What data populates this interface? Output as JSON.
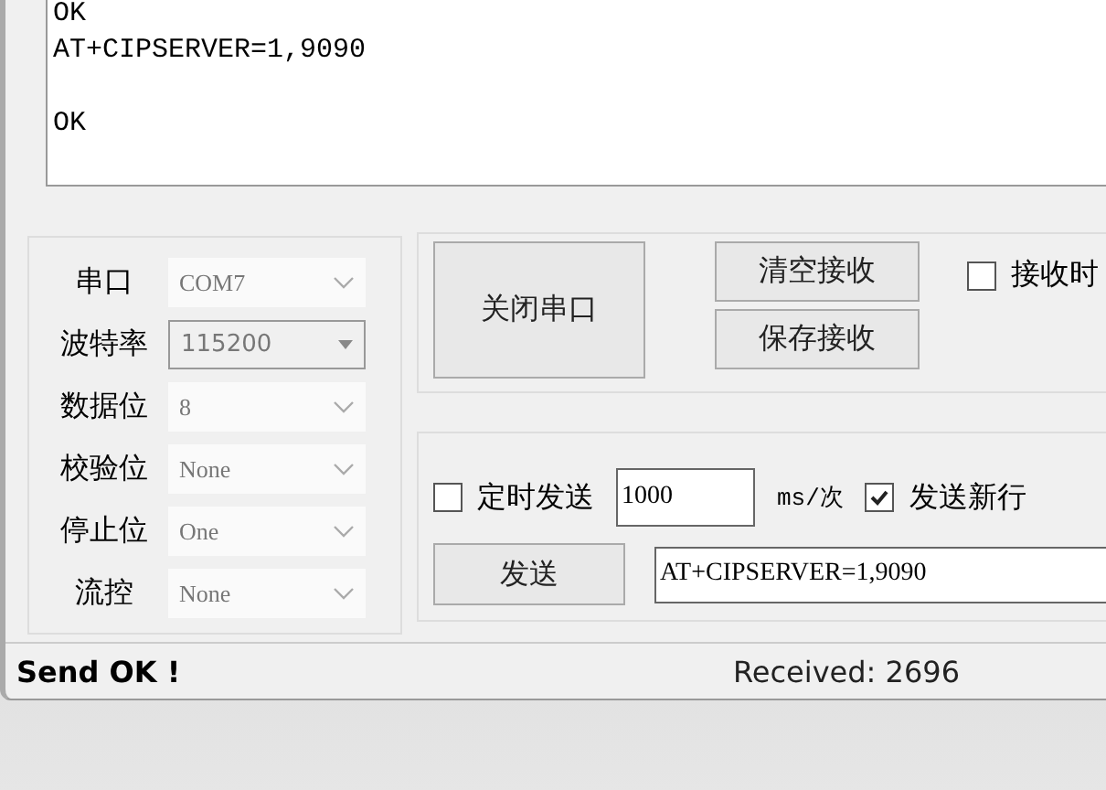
{
  "receive_area": {
    "lines": [
      {
        "text": "OK",
        "gap_before": false
      },
      {
        "text": "AT+CIPSERVER=1,9090",
        "gap_before": false
      },
      {
        "text": "OK",
        "gap_before": true
      }
    ]
  },
  "port_settings": [
    {
      "label": "串口",
      "value": "COM7",
      "kind": "chevron"
    },
    {
      "label": "波特率",
      "value": "115200",
      "kind": "dropdown"
    },
    {
      "label": "数据位",
      "value": "8",
      "kind": "chevron"
    },
    {
      "label": "校验位",
      "value": "None",
      "kind": "chevron"
    },
    {
      "label": "停止位",
      "value": "One",
      "kind": "chevron"
    },
    {
      "label": "流控",
      "value": "None",
      "kind": "chevron"
    }
  ],
  "port_button": "关闭串口",
  "clear_button": "清空接收",
  "save_button": "保存接收",
  "receive_option": {
    "label": "接收时",
    "checked": false
  },
  "timed_send": {
    "label": "定时发送",
    "checked": false
  },
  "interval": {
    "value": "1000",
    "unit": "ms/次"
  },
  "newline": {
    "label": "发送新行",
    "checked": true
  },
  "send_button": "发送",
  "send_field": {
    "value": "AT+CIPSERVER=1,9090"
  },
  "status_bar": {
    "message": "Send OK !",
    "received": "Received: 2696"
  }
}
